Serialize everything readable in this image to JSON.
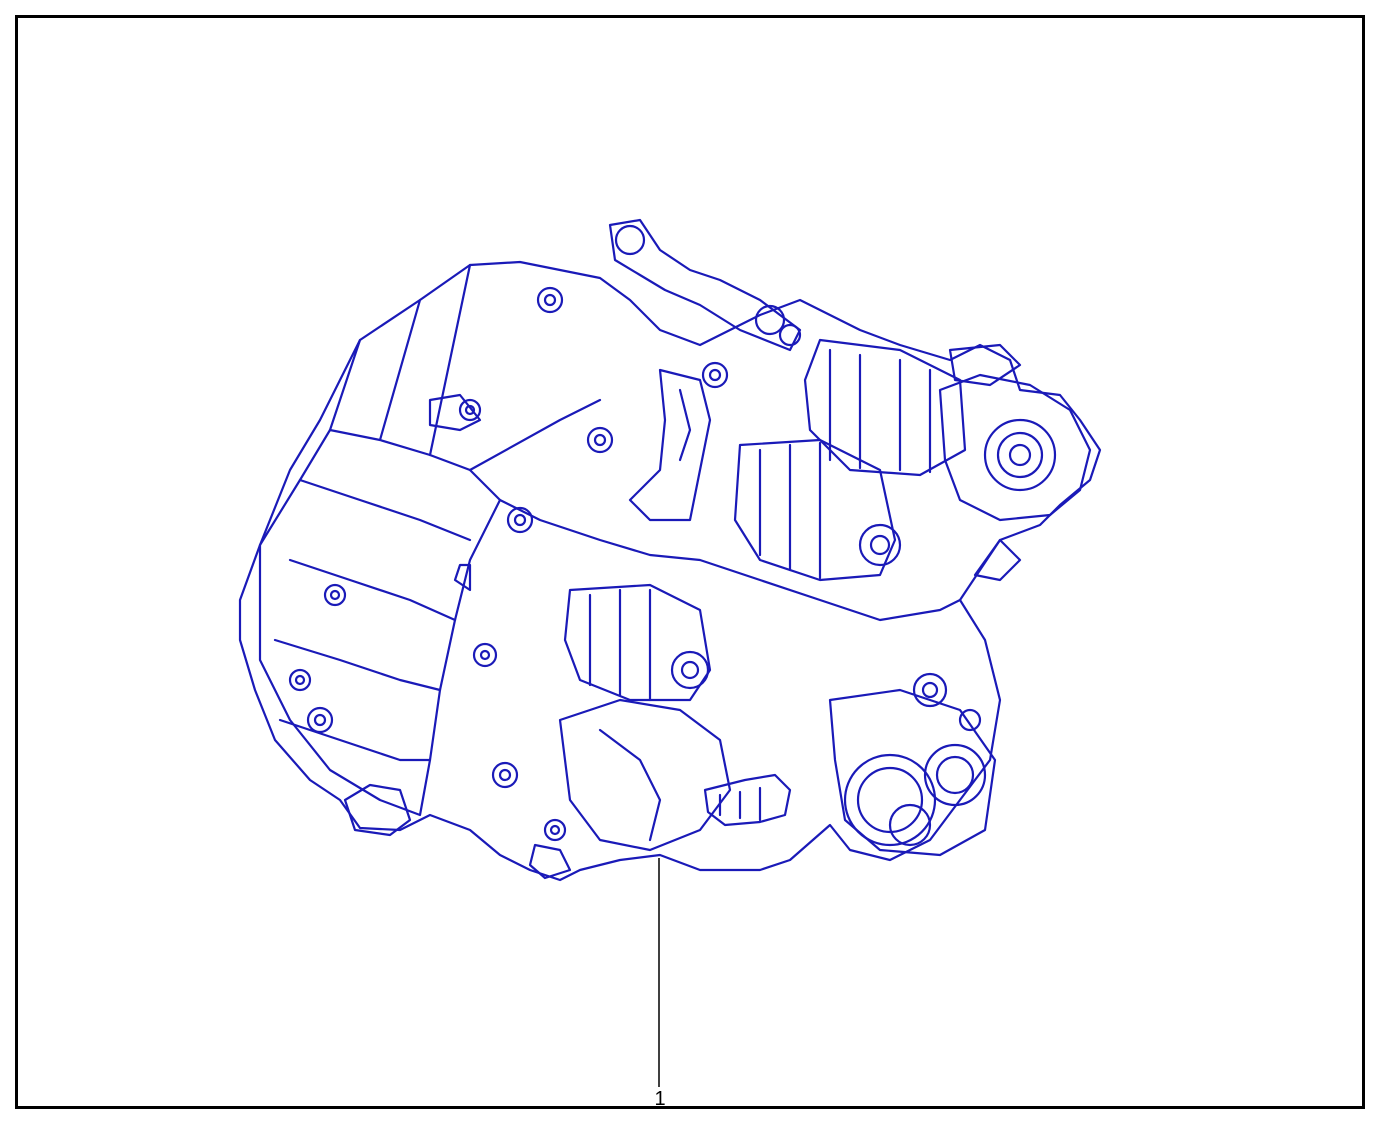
{
  "diagram": {
    "line_color": "#1a1ab8",
    "frame_color": "#000000",
    "callouts": [
      {
        "label": "1"
      }
    ]
  }
}
